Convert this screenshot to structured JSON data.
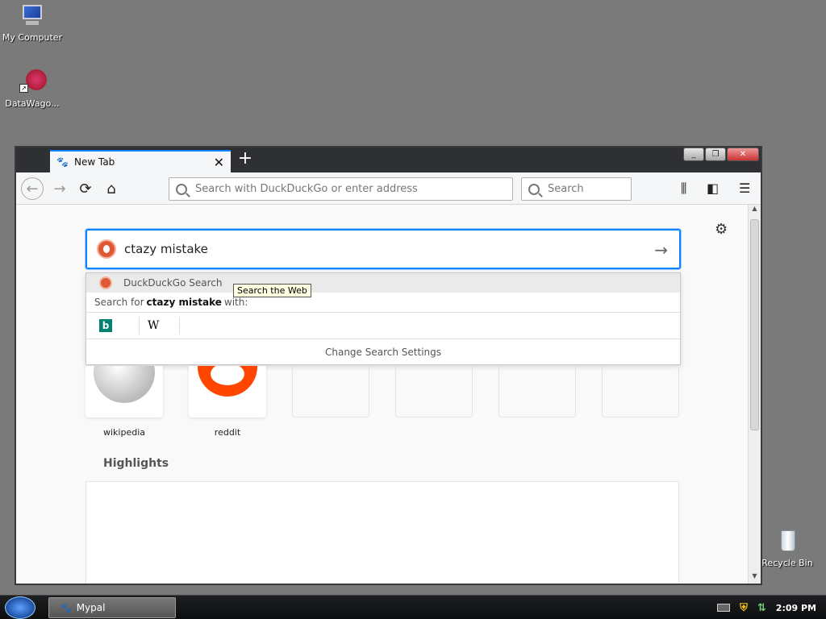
{
  "desktop": {
    "icons": [
      {
        "label": "My Computer"
      },
      {
        "label": "DataWago..."
      },
      {
        "label": "Recycle Bin"
      }
    ]
  },
  "browser": {
    "tab": {
      "title": "New Tab",
      "close": "✕"
    },
    "new_tab": "+",
    "window_buttons": {
      "minimize": "_",
      "restore": "❐",
      "close": "✕"
    },
    "urlbar": {
      "placeholder": "Search with DuckDuckGo or enter address"
    },
    "searchbar": {
      "placeholder": "Search"
    },
    "content": {
      "search_value": "ctazy mistake",
      "dropdown": {
        "engine_label": "DuckDuckGo Search",
        "search_for_prefix": "Search for",
        "search_term": "ctazy mistake",
        "search_for_suffix": "with:",
        "engines": [
          {
            "name": "b"
          },
          {
            "name": "W"
          }
        ],
        "change_settings": "Change Search Settings"
      },
      "tooltip": "Search the Web",
      "top_sites": [
        {
          "label": "wikipedia"
        },
        {
          "label": "reddit"
        },
        {
          "label": ""
        },
        {
          "label": ""
        },
        {
          "label": ""
        },
        {
          "label": ""
        }
      ],
      "highlights_title": "Highlights"
    }
  },
  "taskbar": {
    "app_label": "Mypal",
    "clock": "2:09 PM"
  }
}
